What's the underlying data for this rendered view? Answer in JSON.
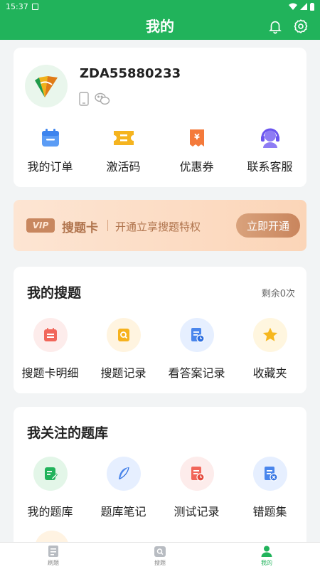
{
  "status_bar": {
    "time": "15:37"
  },
  "header": {
    "title": "我的"
  },
  "profile": {
    "username": "ZDA55880233"
  },
  "quick_actions": [
    {
      "label": "我的订单",
      "icon": "calendar-icon"
    },
    {
      "label": "激活码",
      "icon": "ticket-icon"
    },
    {
      "label": "优惠券",
      "icon": "coupon-icon"
    },
    {
      "label": "联系客服",
      "icon": "headset-icon"
    }
  ],
  "vip": {
    "badge": "VIP",
    "title": "搜题卡",
    "desc": "开通立享搜题特权",
    "button": "立即开通"
  },
  "search_section": {
    "title": "我的搜题",
    "remaining": "剩余0次",
    "items": [
      {
        "label": "搜题卡明细",
        "icon": "card-detail-icon"
      },
      {
        "label": "搜题记录",
        "icon": "search-record-icon"
      },
      {
        "label": "看答案记录",
        "icon": "answer-record-icon"
      },
      {
        "label": "收藏夹",
        "icon": "star-icon"
      }
    ]
  },
  "library_section": {
    "title": "我关注的题库",
    "items": [
      {
        "label": "我的题库",
        "icon": "my-library-icon"
      },
      {
        "label": "题库笔记",
        "icon": "feather-icon"
      },
      {
        "label": "测试记录",
        "icon": "test-record-icon"
      },
      {
        "label": "错题集",
        "icon": "wrong-questions-icon"
      }
    ]
  },
  "tabs": [
    {
      "label": "刷题",
      "active": false
    },
    {
      "label": "搜题",
      "active": false
    },
    {
      "label": "我的",
      "active": true
    }
  ],
  "colors": {
    "brand": "#21b35b",
    "vip_text": "#b0744d",
    "background": "#f2f4f5"
  }
}
